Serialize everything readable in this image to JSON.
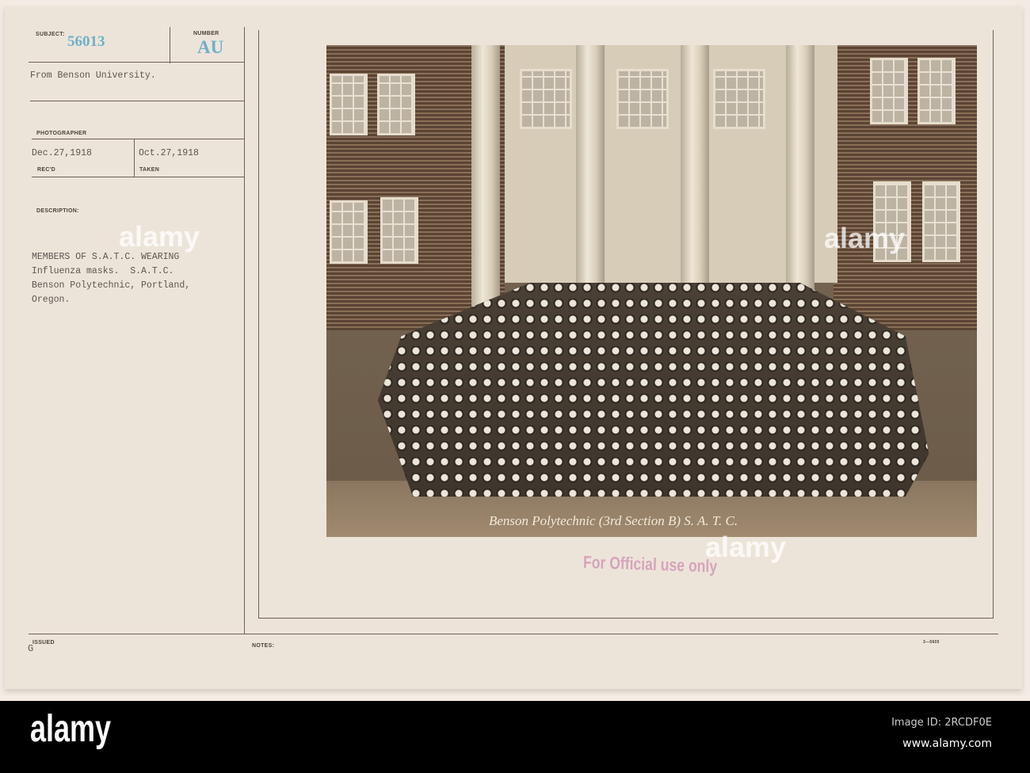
{
  "card": {
    "subject_label": "SUBJECT:",
    "subject_number": "56013",
    "number_label": "NUMBER",
    "number_value": "AU",
    "source": "From Benson University.",
    "photographer_label": "PHOTOGRAPHER",
    "received_date": "Dec.27,1918",
    "received_label": "REC'D",
    "taken_date": "Oct.27,1918",
    "taken_label": "TAKEN",
    "description_label": "DESCRIPTION:",
    "description_lines": [
      "MEMBERS OF S.A.T.C. WEARING",
      "Influenza masks.  S.A.T.C.",
      "Benson Polytechnic, Portland,",
      "Oregon."
    ],
    "issued_label": "ISSUED",
    "issued_mark": "G",
    "notes_label": "NOTES:",
    "form_number": "3—5605"
  },
  "photo": {
    "caption": "Benson Polytechnic (3rd Section B) S. A. T. C."
  },
  "stamp": "For Official use only",
  "watermark": {
    "brand": "alamy",
    "image_id": "Image ID: 2RCDF0E",
    "url": "www.alamy.com"
  }
}
